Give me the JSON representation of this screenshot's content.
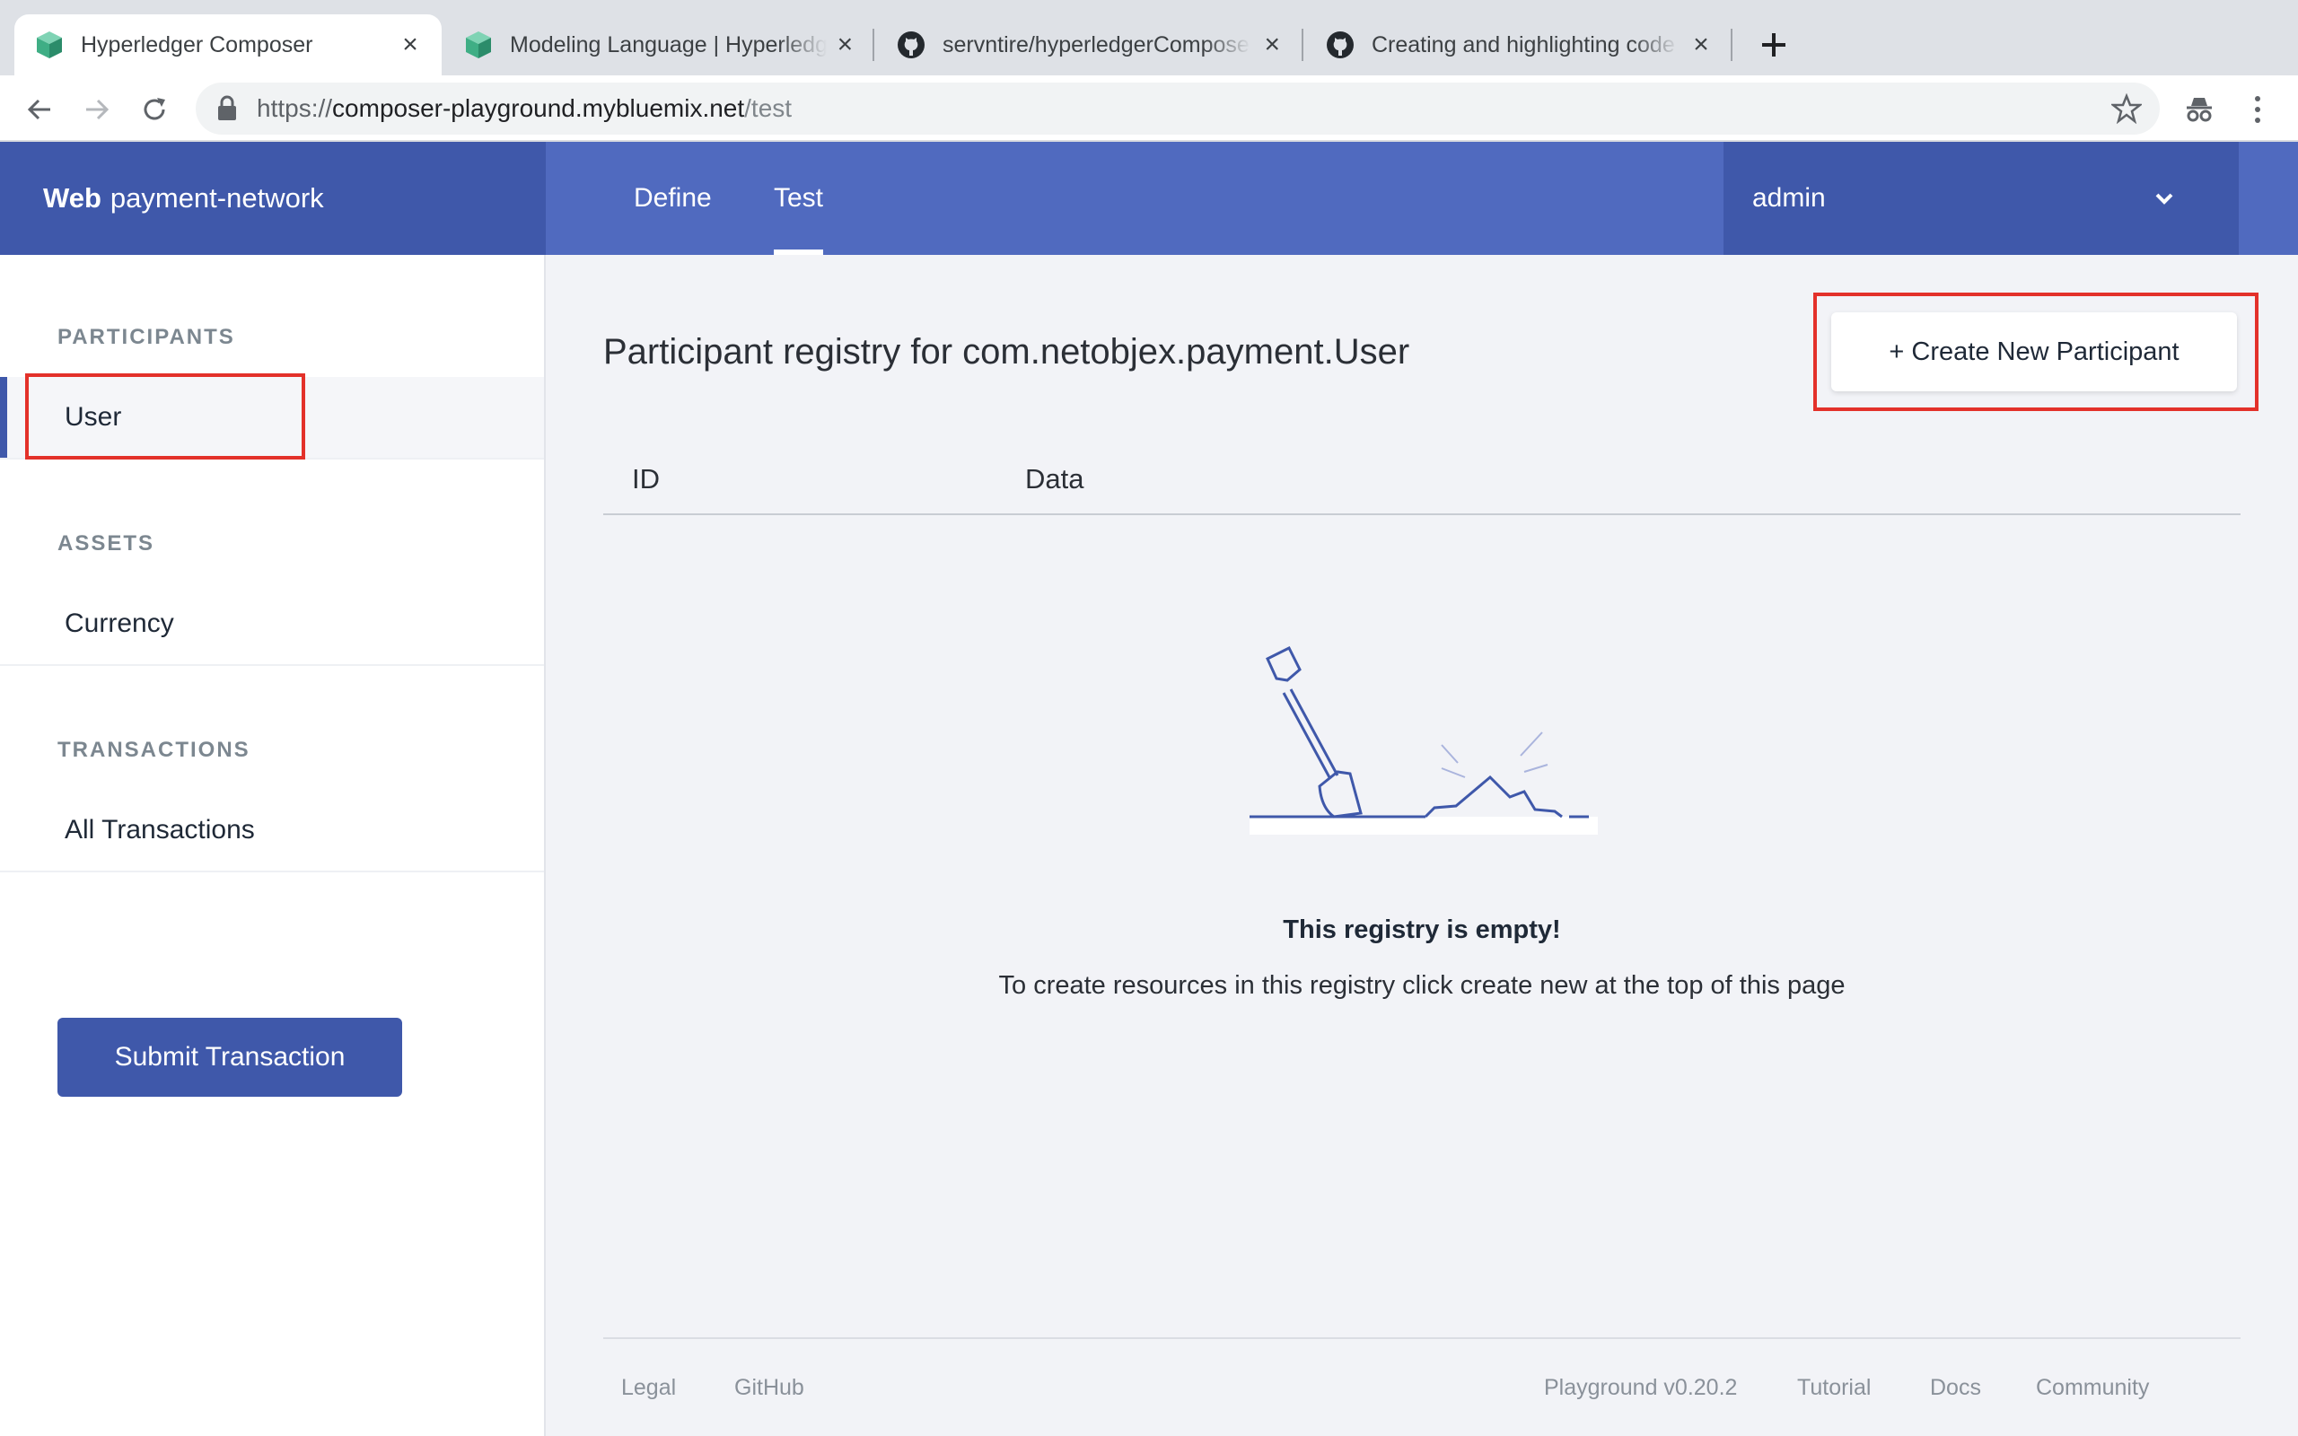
{
  "browser": {
    "tabs": [
      {
        "title": "Hyperledger Composer",
        "icon": "composer-cube-icon",
        "active": true
      },
      {
        "title": "Modeling Language | Hyperledger Composer",
        "icon": "composer-cube-icon",
        "active": false
      },
      {
        "title": "servntire/hyperledgerComposer",
        "icon": "github-icon",
        "active": false
      },
      {
        "title": "Creating and highlighting code",
        "icon": "github-icon",
        "active": false
      }
    ],
    "url": {
      "scheme": "https://",
      "host": "composer-playground.mybluemix.net",
      "path": "/test"
    }
  },
  "header": {
    "brand_bold": "Web",
    "brand_name": "payment-network",
    "tabs": [
      {
        "label": "Define",
        "active": false
      },
      {
        "label": "Test",
        "active": true
      }
    ],
    "identity": "admin"
  },
  "sidebar": {
    "sections": [
      {
        "title": "PARTICIPANTS",
        "items": [
          {
            "label": "User",
            "selected": true
          }
        ]
      },
      {
        "title": "ASSETS",
        "items": [
          {
            "label": "Currency",
            "selected": false
          }
        ]
      },
      {
        "title": "TRANSACTIONS",
        "items": [
          {
            "label": "All Transactions",
            "selected": false
          }
        ]
      }
    ],
    "submit_label": "Submit Transaction"
  },
  "main": {
    "registry_title": "Participant registry for com.netobjex.payment.User",
    "create_label": "+ Create New Participant",
    "columns": [
      "ID",
      "Data"
    ],
    "empty_title": "This registry is empty!",
    "empty_desc": "To create resources in this registry click create new at the top of this page"
  },
  "footer": {
    "links": [
      "Legal",
      "GitHub",
      "Playground v0.20.2",
      "Tutorial",
      "Docs",
      "Community"
    ]
  },
  "colors": {
    "header_bg": "#506abf",
    "header_dark": "#3f58aa",
    "highlight": "#e3312a"
  }
}
